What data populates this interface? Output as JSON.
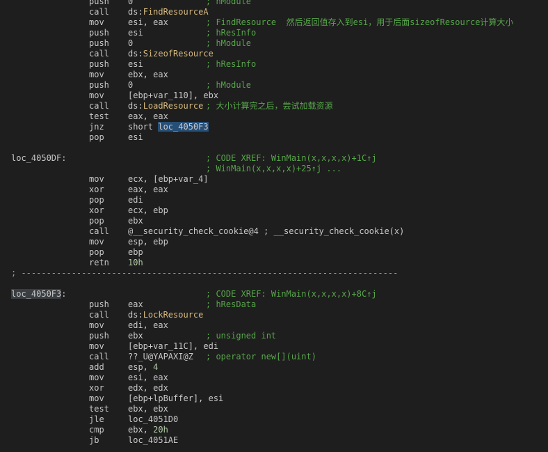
{
  "lines": [
    {
      "mn": "push",
      "op": "0",
      "cm": "; hModule"
    },
    {
      "mn": "call",
      "pre": "ds:",
      "api": "FindResourceA"
    },
    {
      "mn": "mov",
      "op": "esi, eax",
      "cm": "; FindResource  然后返回值存入到esi，用于后面sizeofResource计算大小"
    },
    {
      "mn": "push",
      "op": "esi",
      "cm": "; hResInfo"
    },
    {
      "mn": "push",
      "op": "0",
      "cm": "; hModule"
    },
    {
      "mn": "call",
      "pre": "ds:",
      "api": "SizeofResource"
    },
    {
      "mn": "push",
      "op": "esi",
      "cm": "; hResInfo"
    },
    {
      "mn": "mov",
      "op": "ebx, eax"
    },
    {
      "mn": "push",
      "op": "0",
      "cm": "; hModule"
    },
    {
      "mn": "mov",
      "op": "[ebp+var_110], ebx"
    },
    {
      "mn": "call",
      "pre": "ds:",
      "api": "LoadResource",
      "cm": "; 大小计算完之后，尝试加载资源"
    },
    {
      "mn": "test",
      "op": "eax, eax"
    },
    {
      "mn": "jnz",
      "pre": "short ",
      "hl_a": "loc",
      "hl_b": "_4050F3"
    },
    {
      "mn": "pop",
      "op": "esi"
    },
    {
      "blank": true
    },
    {
      "label": "loc_4050DF:",
      "cm": "; CODE XREF: WinMain(x,x,x,x)+1C↑j"
    },
    {
      "cm": "; WinMain(x,x,x,x)+25↑j ..."
    },
    {
      "mn": "mov",
      "op": "ecx, [ebp+var_4]"
    },
    {
      "mn": "xor",
      "op": "eax, eax"
    },
    {
      "mn": "pop",
      "op": "edi"
    },
    {
      "mn": "xor",
      "op": "ecx, ebp"
    },
    {
      "mn": "pop",
      "op": "ebx"
    },
    {
      "mn": "call",
      "op": "@__security_check_cookie@4 ; __security_check_cookie(x)"
    },
    {
      "mn": "mov",
      "op": "esp, ebp"
    },
    {
      "mn": "pop",
      "op": "ebp"
    },
    {
      "mn": "retn",
      "num": "10h"
    },
    {
      "sep": "; ---------------------------------------------------------------------------"
    },
    {
      "blank": true
    },
    {
      "label_hl": "loc_4050F3",
      "label_tail": ":",
      "cm": "; CODE XREF: WinMain(x,x,x,x)+8C↑j"
    },
    {
      "mn": "push",
      "op": "eax",
      "cm": "; hResData"
    },
    {
      "mn": "call",
      "pre": "ds:",
      "api": "LockResource"
    },
    {
      "mn": "mov",
      "op": "edi, eax"
    },
    {
      "mn": "push",
      "op": "ebx",
      "cm": "; unsigned int"
    },
    {
      "mn": "mov",
      "op": "[ebp+var_11C], edi"
    },
    {
      "mn": "call",
      "op": "??_U@YAPAXI@Z",
      "cm": "; operator new[](uint)"
    },
    {
      "mn": "add",
      "pre": "esp, ",
      "num": "4"
    },
    {
      "mn": "mov",
      "op": "esi, eax"
    },
    {
      "mn": "xor",
      "op": "edx, edx"
    },
    {
      "mn": "mov",
      "op": "[ebp+lpBuffer], esi"
    },
    {
      "mn": "test",
      "op": "ebx, ebx"
    },
    {
      "mn": "jle",
      "op": "loc_4051D0"
    },
    {
      "mn": "cmp",
      "pre": "ebx, ",
      "num": "20h"
    },
    {
      "mn": "jb",
      "op": "loc_4051AE"
    }
  ]
}
